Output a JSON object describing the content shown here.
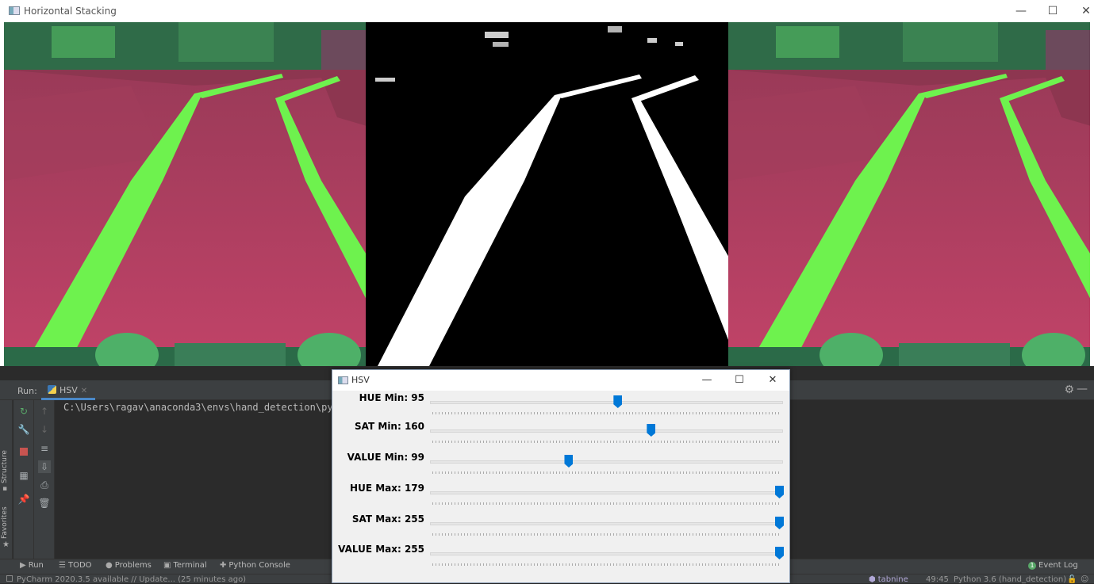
{
  "colors": {
    "accent": "#0078d7",
    "ide_bg": "#2b2b2b",
    "ide_panel": "#3c3f41",
    "lane_green": "#6ef24e",
    "floor_magenta": "#b0405e"
  },
  "main_window": {
    "title": "Horizontal Stacking",
    "icon": "opencv-window-icon"
  },
  "ide": {
    "run_label": "Run:",
    "run_tab": "HSV",
    "console_line": "C:\\Users\\ragav\\anaconda3\\envs\\hand_detection\\py",
    "side_labels": [
      "Structure",
      "Favorites"
    ],
    "bottom_tabs": [
      {
        "label": "Run",
        "icon": "play-icon"
      },
      {
        "label": "TODO",
        "icon": "list-icon"
      },
      {
        "label": "Problems",
        "icon": "info-icon"
      },
      {
        "label": "Terminal",
        "icon": "terminal-icon"
      },
      {
        "label": "Python Console",
        "icon": "python-icon"
      }
    ],
    "event_log": "Event Log",
    "event_log_count": "1",
    "status_left": "PyCharm 2020.3.5 available // Update... (25 minutes ago)",
    "status_tabnine": "tabnine",
    "status_position": "49:45",
    "status_interpreter": "Python 3.6 (hand_detection)"
  },
  "hsv_window": {
    "title": "HSV",
    "trackbars": [
      {
        "label": "HUE Min: 95",
        "value": 95,
        "max": 179
      },
      {
        "label": "SAT Min: 160",
        "value": 160,
        "max": 255
      },
      {
        "label": "VALUE Min: 99",
        "value": 99,
        "max": 255
      },
      {
        "label": "HUE Max: 179",
        "value": 179,
        "max": 179
      },
      {
        "label": "SAT Max: 255",
        "value": 255,
        "max": 255
      },
      {
        "label": "VALUE Max: 255",
        "value": 255,
        "max": 255
      }
    ]
  }
}
